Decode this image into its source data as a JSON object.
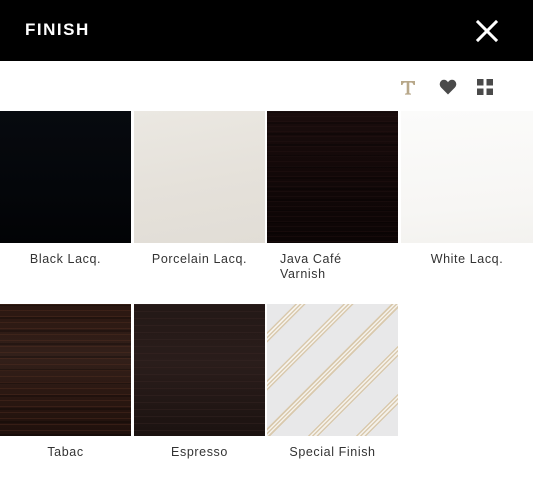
{
  "header": {
    "title": "FINISH",
    "close_icon": "close-icon"
  },
  "toolbar": {
    "icons": [
      "text-sample-icon",
      "heart-icon",
      "grid-view-icon"
    ],
    "text_icon_glyph": "T",
    "accent_color": "#b8a88a"
  },
  "swatches": [
    {
      "label": "Black Lacq.",
      "color": "#05080c"
    },
    {
      "label": "Porcelain Lacq.",
      "color": "#e6e2db"
    },
    {
      "label": "Java Café Varnish",
      "color": "#140a0a"
    },
    {
      "label": "White Lacq.",
      "color": "#f9f8f6"
    },
    {
      "label": "Tabac",
      "color": "#2c1812"
    },
    {
      "label": "Espresso",
      "color": "#1f1513"
    },
    {
      "label": "Special Finish",
      "color": "#e7e7e8"
    }
  ]
}
